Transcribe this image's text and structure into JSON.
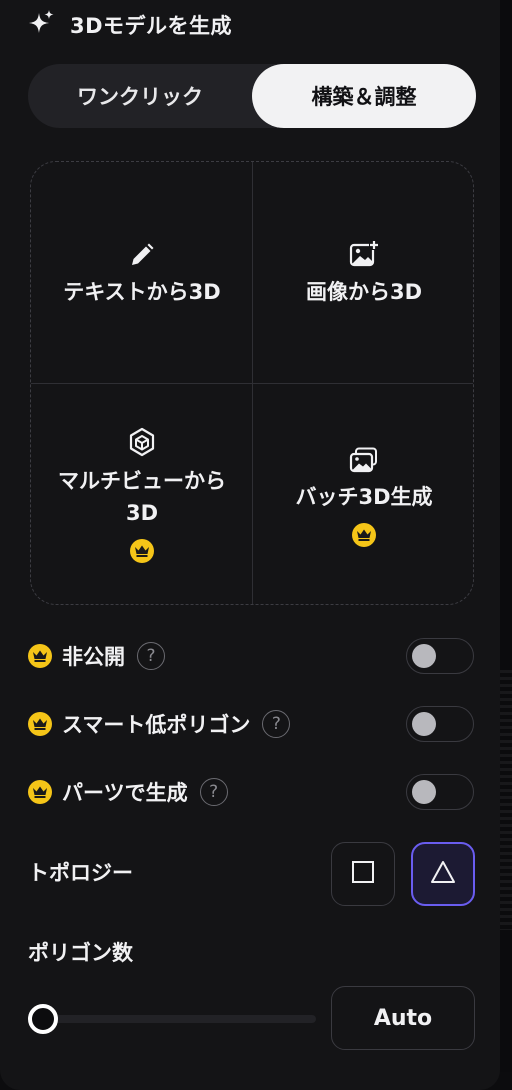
{
  "header": {
    "title": "3Dモデルを生成",
    "icon": "sparkles-icon"
  },
  "mode_tabs": [
    {
      "label": "ワンクリック",
      "selected": false
    },
    {
      "label": "構築＆調整",
      "selected": true
    }
  ],
  "generation_options": [
    {
      "label": "テキストから3D",
      "icon": "pencil-icon",
      "premium": false
    },
    {
      "label": "画像から3D",
      "icon": "image-add-icon",
      "premium": false
    },
    {
      "label_line1": "マルチビューから",
      "label_line2": "3D",
      "icon": "cube-icon",
      "premium": true
    },
    {
      "label": "バッチ3D生成",
      "icon": "images-stack-icon",
      "premium": true
    }
  ],
  "toggles": [
    {
      "label": "非公開",
      "help": "?",
      "premium": true,
      "on": false
    },
    {
      "label": "スマート低ポリゴン",
      "help": "?",
      "premium": true,
      "on": false
    },
    {
      "label": "パーツで生成",
      "help": "?",
      "premium": true,
      "on": false
    }
  ],
  "topology": {
    "label": "トポロジー",
    "options": [
      {
        "name": "quad",
        "icon": "square-icon",
        "selected": false
      },
      {
        "name": "triangle",
        "icon": "triangle-icon",
        "selected": true
      }
    ]
  },
  "polycount": {
    "label": "ポリゴン数",
    "slider_value": 0,
    "auto_label": "Auto"
  },
  "colors": {
    "accent": "#6a5df0",
    "premium": "#f5c518",
    "panel_bg": "#141416"
  }
}
